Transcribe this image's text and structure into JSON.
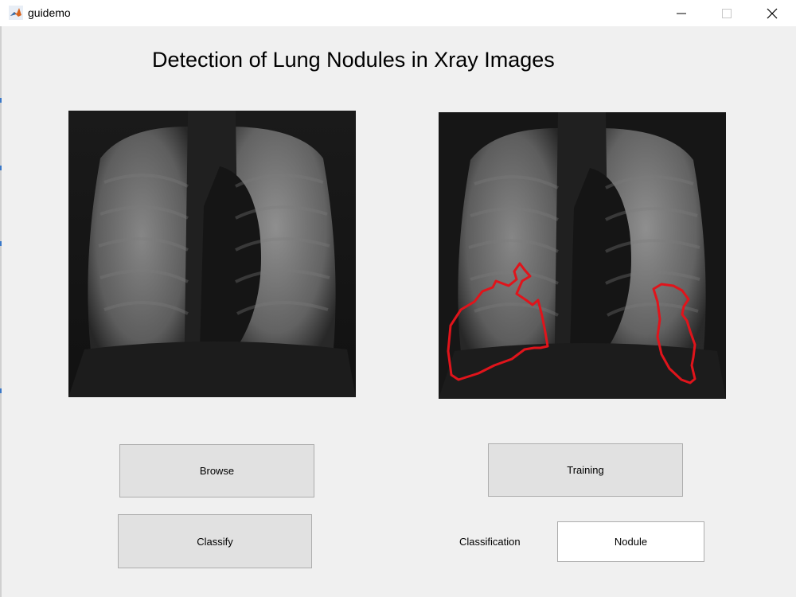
{
  "window": {
    "title": "guidemo",
    "app_icon": "matlab-icon",
    "controls": {
      "minimize_icon": "minimize-icon",
      "maximize_icon": "maximize-icon",
      "close_icon": "close-icon"
    }
  },
  "main": {
    "title": "Detection of Lung Nodules in Xray Images",
    "input_image": {
      "icon": "chest-xray-image"
    },
    "output_image": {
      "icon": "chest-xray-segmented-image",
      "outline_color": "#e0141b"
    }
  },
  "buttons": {
    "browse": "Browse",
    "classify": "Classify",
    "training": "Training"
  },
  "classification": {
    "label": "Classification",
    "result": "Nodule"
  }
}
